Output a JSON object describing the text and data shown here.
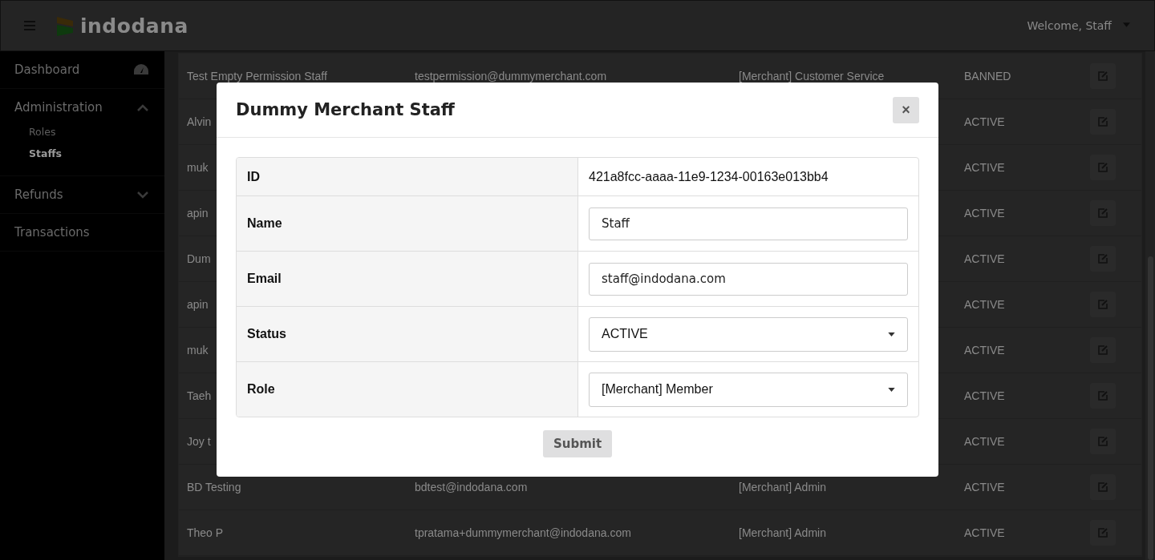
{
  "header": {
    "logo": "indodana",
    "user": "Welcome, Staff"
  },
  "sidebar": {
    "items": [
      {
        "label": "Dashboard",
        "kind": "icon",
        "selected": false
      },
      {
        "label": "Administration",
        "kind": "group",
        "expanded": true,
        "children": [
          {
            "label": "Roles",
            "selected": false
          },
          {
            "label": "Staffs",
            "selected": true
          }
        ]
      },
      {
        "label": "Refunds",
        "kind": "group",
        "expanded": false
      },
      {
        "label": "Transactions",
        "kind": "plain",
        "selected": false
      }
    ]
  },
  "table": {
    "rows": [
      {
        "name": "Test Empty Permission Staff",
        "email": "testpermission@dummymerchant.com",
        "role": "[Merchant] Customer Service",
        "status": "BANNED"
      },
      {
        "name": "Alvin",
        "status": "ACTIVE"
      },
      {
        "name": "muk",
        "status": "ACTIVE"
      },
      {
        "name": "apin",
        "status": "ACTIVE"
      },
      {
        "name": "Dum",
        "status": "ACTIVE"
      },
      {
        "name": "apin",
        "status": "ACTIVE"
      },
      {
        "name": "muk",
        "status": "ACTIVE"
      },
      {
        "name": "Taeh",
        "status": "ACTIVE"
      },
      {
        "name": "Joy t",
        "status": "ACTIVE"
      },
      {
        "name": "BD Testing",
        "email": "bdtest@indodana.com",
        "role": "[Merchant] Admin",
        "status": "ACTIVE"
      },
      {
        "name": "Theo P",
        "email": "tpratama+dummymerchant@indodana.com",
        "role": "[Merchant] Admin",
        "status": "ACTIVE"
      }
    ]
  },
  "modal": {
    "title": "Dummy Merchant Staff",
    "close": "×",
    "fields": [
      {
        "label": "ID",
        "kind": "text",
        "value": "421a8fcc-aaaa-11e9-1234-00163e013bb4"
      },
      {
        "label": "Name",
        "kind": "input",
        "value": "Staff"
      },
      {
        "label": "Email",
        "kind": "input",
        "value": "staff@indodana.com"
      },
      {
        "label": "Status",
        "kind": "select",
        "value": "ACTIVE"
      },
      {
        "label": "Role",
        "kind": "select",
        "value": "[Merchant] Member"
      }
    ],
    "submit": "Submit"
  }
}
